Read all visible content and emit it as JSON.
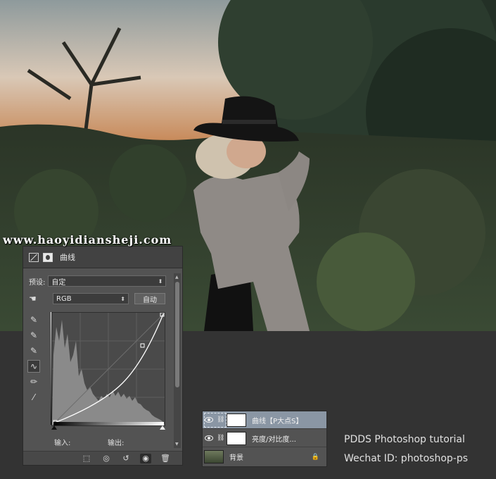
{
  "watermark": "www.haoyidiansheji.com",
  "curves_panel": {
    "title": "曲线",
    "header_icons": [
      "curves-adjustment-icon",
      "layer-mask-icon"
    ],
    "preset_label": "预设:",
    "preset_value": "自定",
    "channel_value": "RGB",
    "auto_button": "自动",
    "input_label": "输入:",
    "output_label": "输出:",
    "tools": [
      "target-adjust-icon",
      "black-eyedropper-icon",
      "gray-eyedropper-icon",
      "white-eyedropper-icon",
      "curve-point-icon",
      "pencil-icon",
      "smooth-icon"
    ],
    "footer_icons": [
      "clip-to-layer-icon",
      "view-previous-icon",
      "reset-icon",
      "visibility-icon",
      "delete-icon"
    ]
  },
  "layers_panel": {
    "layers": [
      {
        "name": "曲线【P大点S】",
        "selected": true,
        "type": "adjustment"
      },
      {
        "name": "亮度/对比度...",
        "selected": false,
        "type": "adjustment"
      },
      {
        "name": "背景",
        "selected": false,
        "type": "background",
        "locked": true
      }
    ]
  },
  "credits": {
    "line1": "PDDS Photoshop tutorial",
    "line2": "Wechat ID: photoshop-ps"
  }
}
